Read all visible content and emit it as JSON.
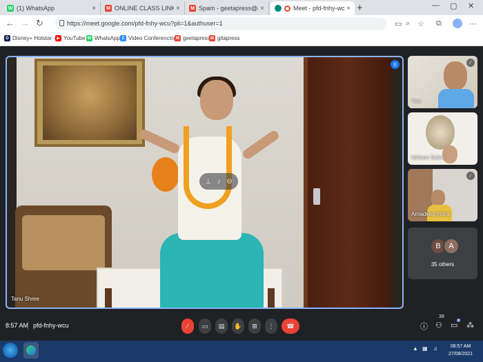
{
  "browser": {
    "tabs": [
      {
        "title": "(1) WhatsApp",
        "favicon_color": "#25d366",
        "favicon_glyph": "W"
      },
      {
        "title": "ONLINE CLASS LINK - geetapress",
        "favicon_color": "#ea4335",
        "favicon_glyph": "M"
      },
      {
        "title": "Spam - geetapress@gmail.com",
        "favicon_color": "#ea4335",
        "favicon_glyph": "M"
      },
      {
        "title": "Meet - pfd-fnhy-wcu",
        "favicon_color": "#00897b",
        "favicon_glyph": ""
      }
    ],
    "new_tab_label": "+",
    "close_glyph": "×",
    "url": "https://meet.google.com/pfd-fnhy-wcu?pli=1&authuser=1",
    "bookmarks": [
      {
        "label": "Disney+ Hotstar -...",
        "color": "#0f1c4d",
        "glyph": "D"
      },
      {
        "label": "YouTube",
        "color": "#ff0000",
        "glyph": "▶"
      },
      {
        "label": "WhatsApp",
        "color": "#25d366",
        "glyph": "W"
      },
      {
        "label": "Video Conferencing...",
        "color": "#2d8cff",
        "glyph": "Z"
      },
      {
        "label": "geetapress",
        "color": "#ea4335",
        "glyph": "M"
      },
      {
        "label": "gitapress",
        "color": "#ea4335",
        "glyph": "M"
      }
    ]
  },
  "meet": {
    "main_participant": "Tanu Shree",
    "participants": [
      {
        "name": "You"
      },
      {
        "name": "Ishleen Sahni"
      },
      {
        "name": "Arnadeep Indra"
      }
    ],
    "others": {
      "avatars": [
        "B",
        "A"
      ],
      "label": "35 others"
    },
    "time": "8:57 AM",
    "meeting_code": "pfd-fnhy-wcu",
    "participant_count": "39",
    "accent": "#8ab4f8",
    "leave_color": "#ea4335"
  },
  "taskbar": {
    "time": "08:57 AM",
    "date": "27/08/2021"
  }
}
